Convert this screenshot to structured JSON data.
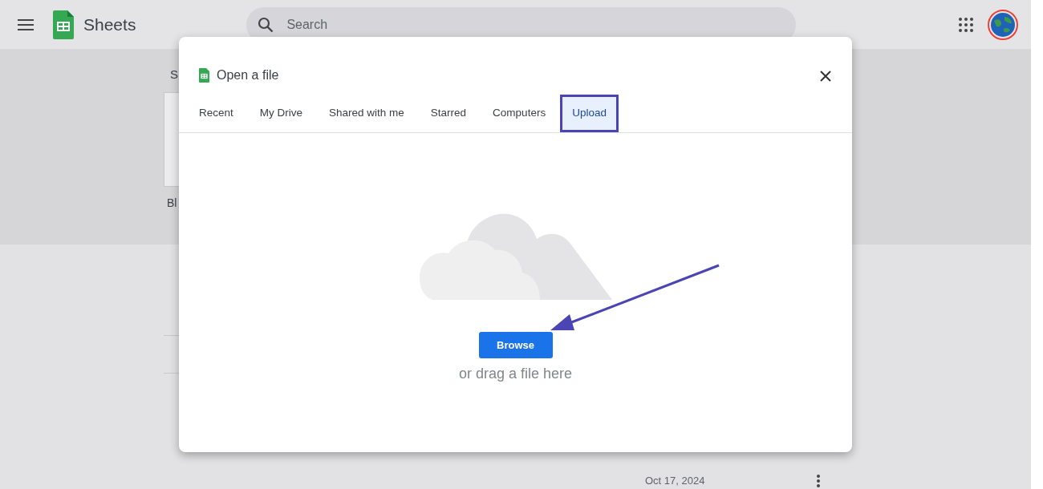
{
  "app_bar": {
    "title": "Sheets",
    "search": {
      "placeholder": "Search"
    }
  },
  "background": {
    "section_heading": "S",
    "file_name": "Bl",
    "file_date": "Oct 17, 2024"
  },
  "dialog": {
    "title": "Open a file",
    "tabs": [
      {
        "label": "Recent",
        "selected": false
      },
      {
        "label": "My Drive",
        "selected": false
      },
      {
        "label": "Shared with me",
        "selected": false
      },
      {
        "label": "Starred",
        "selected": false
      },
      {
        "label": "Computers",
        "selected": false
      },
      {
        "label": "Upload",
        "selected": true
      }
    ],
    "browse_button": "Browse",
    "drop_hint": "or drag a file here"
  }
}
